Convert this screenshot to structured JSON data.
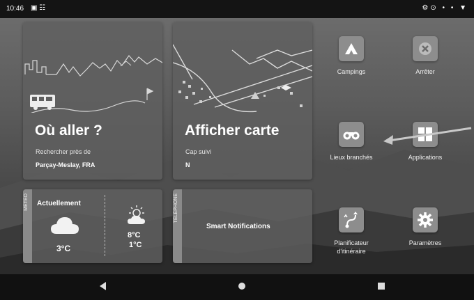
{
  "status_bar": {
    "time": "10:46",
    "left_icons": "▣ ☷",
    "right_icons": "⚙⊙ • • ▼"
  },
  "cards": {
    "where_to": {
      "title": "Où aller ?",
      "subtitle": "Rechercher près de",
      "location": "Parçay-Meslay, FRA"
    },
    "show_map": {
      "title": "Afficher carte",
      "heading_label": "Cap suivi",
      "heading_value": "N"
    },
    "weather": {
      "tab_label": "MÉTÉO",
      "now_label": "Actuellement",
      "now_temp": "3°C",
      "high": "8°C",
      "low": "1°C"
    },
    "phone": {
      "tab_label": "TÉLÉPHONE",
      "label": "Smart Notifications"
    }
  },
  "apps": [
    {
      "label": "Campings",
      "icon": "tent-icon"
    },
    {
      "label": "Arrêter",
      "icon": "stop-icon"
    },
    {
      "label": "Lieux branchés",
      "icon": "binoculars-icon"
    },
    {
      "label": "Applications",
      "icon": "apps-grid-icon"
    },
    {
      "label": "Planificateur d'itinéraire",
      "icon": "route-planner-icon"
    },
    {
      "label": "Paramètres",
      "icon": "gear-icon"
    }
  ],
  "colors": {
    "card_bg": "#5f5f5f",
    "icon_bg": "#8d8d8d",
    "status_bar": "#141414"
  }
}
